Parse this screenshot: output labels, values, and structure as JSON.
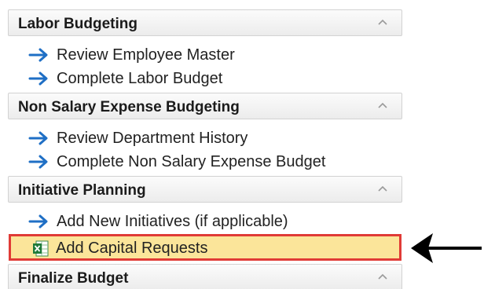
{
  "sections": [
    {
      "title": "Labor Budgeting",
      "items": [
        "Review Employee Master",
        "Complete Labor Budget"
      ]
    },
    {
      "title": "Non Salary Expense Budgeting",
      "items": [
        "Review Department History",
        "Complete Non Salary Expense Budget"
      ]
    },
    {
      "title": "Initiative Planning",
      "items": [
        "Add New Initiatives (if applicable)"
      ],
      "selected_item": "Add Capital Requests"
    },
    {
      "title": "Finalize Budget",
      "items": []
    }
  ],
  "icons": {
    "collapse": "chevron-up-icon",
    "task": "arrow-right-icon",
    "selected_task": "spreadsheet-icon",
    "annotation": "pointer-arrow-icon"
  },
  "colors": {
    "arrow": "#1f6fc5",
    "highlight_fill": "#fbe59a",
    "highlight_border": "#e03b36"
  }
}
